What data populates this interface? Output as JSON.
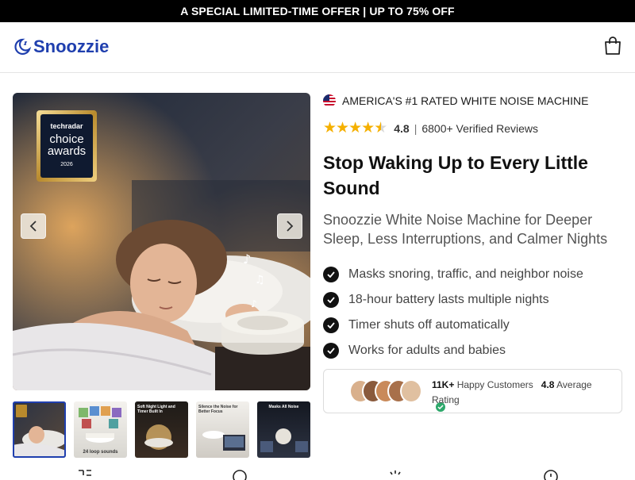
{
  "announcement": "A SPECIAL LIMITED-TIME OFFER | UP TO 75% OFF",
  "header": {
    "logo_text": "Snoozzie",
    "brand_color": "#1f3fae"
  },
  "gallery": {
    "badge": {
      "brand": "techradar",
      "line1": "choice",
      "line2": "awards",
      "year": "2026"
    },
    "thumbnails": [
      {
        "top_caption": "",
        "bottom_caption": ""
      },
      {
        "top_caption": "",
        "bottom_caption": "24 loop sounds"
      },
      {
        "top_caption": "Soft Night Light and Timer Built In",
        "bottom_caption": ""
      },
      {
        "top_caption": "Silence the Noise for Better Focus",
        "bottom_caption": ""
      },
      {
        "top_caption": "Masks All Noise",
        "bottom_caption": ""
      }
    ]
  },
  "product": {
    "tagline": "AMERICA'S #1 RATED WHITE NOISE MACHINE",
    "rating": "4.8",
    "rating_separator": "|",
    "reviews": "6800+ Verified Reviews",
    "title": "Stop Waking Up to Every Little Sound",
    "subtitle": "Snoozzie White Noise Machine for Deeper Sleep, Less Interruptions, and Calmer Nights",
    "benefits": [
      "Masks snoring, traffic, and neighbor noise",
      "18-hour battery lasts multiple nights",
      "Timer shuts off automatically",
      "Works for adults and babies"
    ],
    "social_proof": {
      "customers_count": "11K+",
      "customers_label": "Happy Customers",
      "avg_rating": "4.8",
      "avg_label": "Average Rating"
    }
  },
  "icons": [
    "cart-icon",
    "chevron-left-icon",
    "chevron-right-icon",
    "star-icon",
    "check-icon",
    "us-flag-icon"
  ],
  "colors": {
    "star": "#f5b000",
    "verify": "#2ea86b",
    "announcement_bg": "#000000"
  }
}
